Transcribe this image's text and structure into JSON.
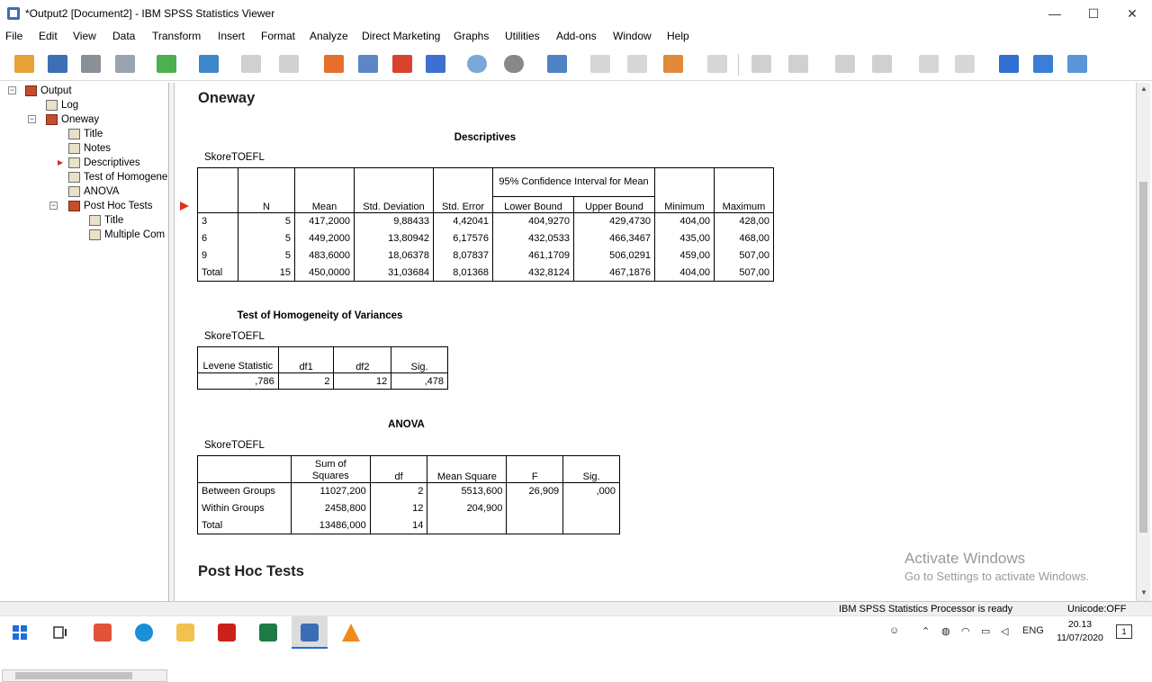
{
  "window": {
    "title": "*Output2 [Document2] - IBM SPSS Statistics Viewer",
    "min": "—",
    "max": "☐",
    "close": "✕"
  },
  "menu": [
    "File",
    "Edit",
    "View",
    "Data",
    "Transform",
    "Insert",
    "Format",
    "Analyze",
    "Direct Marketing",
    "Graphs",
    "Utilities",
    "Add-ons",
    "Window",
    "Help"
  ],
  "toolbar": {
    "icons": [
      "open-icon",
      "save-icon",
      "print-icon",
      "print-preview-icon",
      "export-icon",
      "recall-dialog-icon",
      "undo-icon",
      "redo-icon",
      "goto-data-icon",
      "goto-case-icon",
      "goto-variable-icon",
      "variables-icon",
      "select-cases-icon",
      "weight-cases-icon",
      "split-file-icon",
      "value-labels-icon",
      "designate-window-icon",
      "show-all-variables-icon",
      "insert-title-icon",
      "previous-icon",
      "next-icon",
      "expand-icon",
      "collapse-icon",
      "show-icon",
      "hide-icon",
      "insert-heading-icon",
      "insert-text-icon",
      "insert-new-icon"
    ]
  },
  "outline": {
    "output": "Output",
    "log": "Log",
    "oneway": "Oneway",
    "title": "Title",
    "notes": "Notes",
    "descriptives": "Descriptives",
    "homogeneity": "Test of Homogene",
    "anova": "ANOVA",
    "posthoc": "Post Hoc Tests",
    "posthoc_title": "Title",
    "multiple": "Multiple Com"
  },
  "content": {
    "oneway_heading": "Oneway",
    "posthoc_heading": "Post Hoc Tests",
    "descriptives": {
      "title": "Descriptives",
      "variable": "SkoreTOEFL",
      "ci_header": "95% Confidence Interval for Mean",
      "headers": [
        "N",
        "Mean",
        "Std. Deviation",
        "Std. Error",
        "Lower Bound",
        "Upper Bound",
        "Minimum",
        "Maximum"
      ],
      "rows": [
        {
          "label": "3",
          "cells": [
            "5",
            "417,2000",
            "9,88433",
            "4,42041",
            "404,9270",
            "429,4730",
            "404,00",
            "428,00"
          ]
        },
        {
          "label": "6",
          "cells": [
            "5",
            "449,2000",
            "13,80942",
            "6,17576",
            "432,0533",
            "466,3467",
            "435,00",
            "468,00"
          ]
        },
        {
          "label": "9",
          "cells": [
            "5",
            "483,6000",
            "18,06378",
            "8,07837",
            "461,1709",
            "506,0291",
            "459,00",
            "507,00"
          ]
        },
        {
          "label": "Total",
          "cells": [
            "15",
            "450,0000",
            "31,03684",
            "8,01368",
            "432,8124",
            "467,1876",
            "404,00",
            "507,00"
          ]
        }
      ]
    },
    "homogeneity": {
      "title": "Test of Homogeneity of Variances",
      "variable": "SkoreTOEFL",
      "headers": [
        "Levene Statistic",
        "df1",
        "df2",
        "Sig."
      ],
      "row": [
        ",786",
        "2",
        "12",
        ",478"
      ]
    },
    "anova": {
      "title": "ANOVA",
      "variable": "SkoreTOEFL",
      "headers": [
        "Sum of Squares",
        "df",
        "Mean Square",
        "F",
        "Sig."
      ],
      "rows": [
        {
          "label": "Between Groups",
          "cells": [
            "11027,200",
            "2",
            "5513,600",
            "26,909",
            ",000"
          ]
        },
        {
          "label": "Within Groups",
          "cells": [
            "2458,800",
            "12",
            "204,900",
            "",
            ""
          ]
        },
        {
          "label": "Total",
          "cells": [
            "13486,000",
            "14",
            "",
            "",
            ""
          ]
        }
      ]
    }
  },
  "watermark": {
    "line1": "Activate Windows",
    "line2": "Go to Settings to activate Windows."
  },
  "status": {
    "processor": "IBM SPSS Statistics Processor is ready",
    "unicode": "Unicode:OFF"
  },
  "taskbar": {
    "lang": "ENG",
    "time": "20.13",
    "date": "11/07/2020",
    "notif": "1"
  }
}
